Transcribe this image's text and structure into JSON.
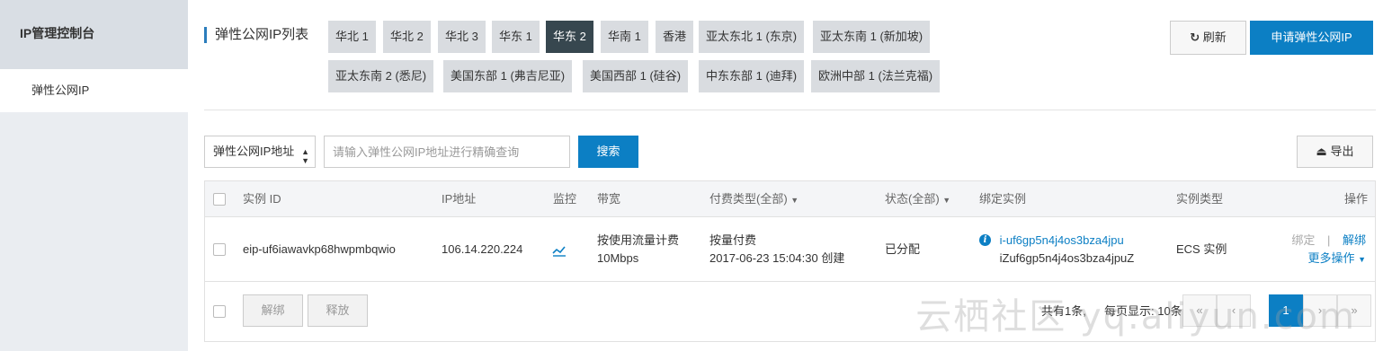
{
  "sidebar": {
    "title": "IP管理控制台",
    "items": [
      {
        "label": "弹性公网IP"
      }
    ]
  },
  "header": {
    "title": "弹性公网IP列表",
    "regions_row1": [
      "华北 1",
      "华北 2",
      "华北 3",
      "华东 1",
      "华东 2",
      "华南 1",
      "香港",
      "亚太东北 1 (东京)",
      "亚太东南 1 (新加坡)"
    ],
    "regions_row2": [
      "亚太东南 2 (悉尼)",
      "美国东部 1 (弗吉尼亚)",
      "美国西部 1 (硅谷)",
      "中东东部 1 (迪拜)",
      "欧洲中部 1 (法兰克福)"
    ],
    "active_region": "华东 2",
    "refresh_label": "刷新",
    "apply_label": "申请弹性公网IP"
  },
  "search": {
    "select_value": "弹性公网IP地址",
    "placeholder": "请输入弹性公网IP地址进行精确查询",
    "search_label": "搜索",
    "export_label": "导出"
  },
  "table": {
    "columns": [
      "实例 ID",
      "IP地址",
      "监控",
      "带宽",
      "付费类型(全部)",
      "状态(全部)",
      "绑定实例",
      "实例类型",
      "操作"
    ],
    "rows": [
      {
        "id": "eip-uf6iawavkp68hwpmbqwio",
        "ip": "106.14.220.224",
        "bandwidth_type": "按使用流量计费",
        "bandwidth": "10Mbps",
        "pay_type": "按量付费",
        "created": "2017-06-23 15:04:30 创建",
        "status": "已分配",
        "bound_line1": "i-uf6gp5n4j4os3bza4jpu",
        "bound_line2": "iZuf6gp5n4j4os3bza4jpuZ",
        "instance_type": "ECS 实例",
        "action_bind": "绑定",
        "action_sep": "|",
        "action_unbind": "解绑",
        "action_more": "更多操作"
      }
    ]
  },
  "footer": {
    "unbind_label": "解绑",
    "release_label": "释放",
    "total_text": "共有1条,",
    "per_page_text": "每页显示: 10条",
    "current_page": "1",
    "prev2": "«",
    "prev1": "‹",
    "next1": "›",
    "next2": "»"
  },
  "watermark": "云栖社区 yq.aliyun.com",
  "colors": {
    "accent": "#0c7fc4",
    "active_region": "#37474f",
    "status_green": "#2e9e3e"
  }
}
